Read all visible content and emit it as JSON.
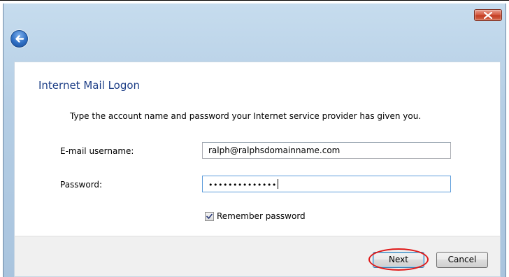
{
  "dialog": {
    "heading": "Internet Mail Logon",
    "instructions": "Type the account name and password your Internet service provider has given you."
  },
  "form": {
    "username": {
      "label": "E-mail username:",
      "value": "ralph@ralphsdomainname.com"
    },
    "password": {
      "label": "Password:",
      "masked_value": "••••••••••••••"
    },
    "remember_password": {
      "label": "Remember password",
      "checked": true
    }
  },
  "buttons": {
    "next": "Next",
    "cancel": "Cancel"
  },
  "icons": {
    "back": "back-arrow-icon",
    "close": "close-icon",
    "checkmark": "checkmark-icon"
  },
  "colors": {
    "heading": "#1e3f87",
    "close_button": "#c13b22",
    "back_button": "#2f6fc4",
    "highlight_ring": "#e01a1a"
  }
}
